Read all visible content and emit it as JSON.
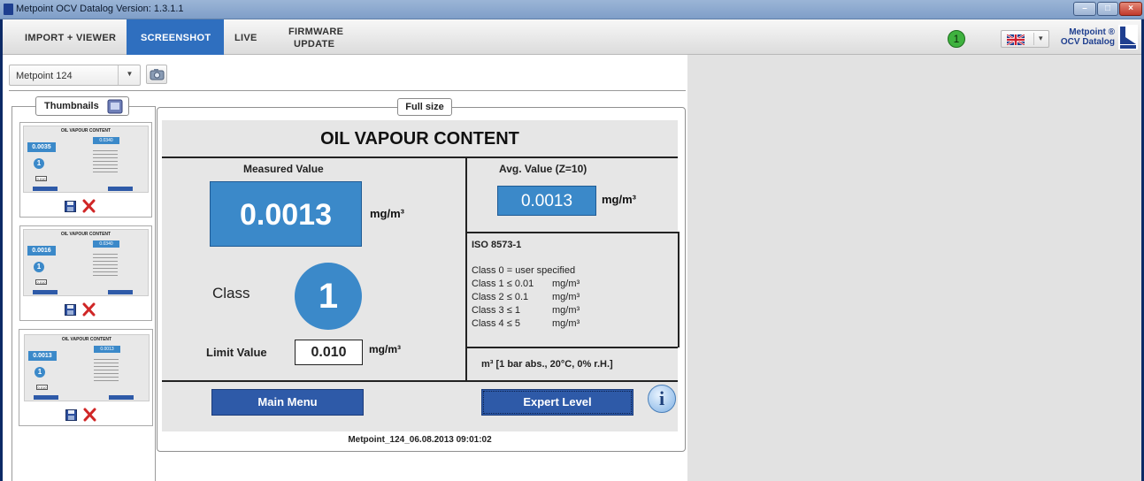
{
  "window": {
    "title": "Metpoint OCV Datalog Version: 1.3.1.1",
    "controls": [
      "–",
      "□",
      "×"
    ]
  },
  "menu": {
    "tabs": [
      {
        "label": "IMPORT + VIEWER",
        "active": false
      },
      {
        "label": "SCREENSHOT",
        "active": true
      },
      {
        "label": "LIVE",
        "active": false
      },
      {
        "label_line1": "FIRMWARE",
        "label_line2": "UPDATE",
        "active": false
      }
    ],
    "badge": "1",
    "brand_line1": "Metpoint ®",
    "brand_line2": "OCV Datalog"
  },
  "device": {
    "selected": "Metpoint 124"
  },
  "thumbnails": {
    "title": "Thumbnails",
    "items": [
      {
        "value": "0.0035",
        "avg": "0.0340",
        "limit": "0.010",
        "class": "1"
      },
      {
        "value": "0.0016",
        "avg": "0.0340",
        "limit": "0.010",
        "class": "1"
      },
      {
        "value": "0.0013",
        "avg": "0.0013",
        "limit": "0.010",
        "class": "1"
      }
    ],
    "mini_title": "OIL VAPOUR CONTENT"
  },
  "fullsize": {
    "label": "Full size",
    "title": "OIL VAPOUR CONTENT",
    "measured_label": "Measured Value",
    "measured_value": "0.0013",
    "measured_unit": "mg/m³",
    "avg_label": "Avg. Value (Z=10)",
    "avg_value": "0.0013",
    "avg_unit": "mg/m³",
    "class_label": "Class",
    "class_value": "1",
    "limit_label": "Limit Value",
    "limit_value": "0.010",
    "limit_unit": "mg/m³",
    "iso_title": "ISO 8573-1",
    "iso_lines": [
      {
        "text": "Class 0 = user specified",
        "unit": ""
      },
      {
        "text": "Class 1 ≤ 0.01",
        "unit": "mg/m³"
      },
      {
        "text": "Class 2 ≤ 0.1",
        "unit": "mg/m³"
      },
      {
        "text": "Class 3 ≤ 1",
        "unit": "mg/m³"
      },
      {
        "text": "Class 4 ≤ 5",
        "unit": "mg/m³"
      }
    ],
    "reference": "m³ [1 bar abs., 20°C, 0% r.H.]",
    "main_menu": "Main Menu",
    "expert_level": "Expert Level",
    "info_icon": "i",
    "footer": "Metpoint_124_06.08.2013 09:01:02"
  }
}
